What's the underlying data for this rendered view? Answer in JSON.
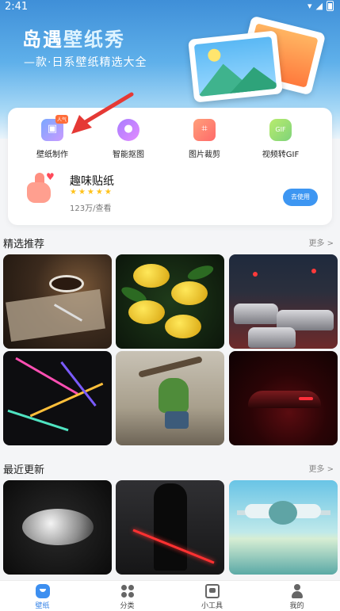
{
  "status_bar": {
    "time": "2:41"
  },
  "hero": {
    "title_part1": "岛遇",
    "title_part2": "壁纸秀",
    "subtitle": "—款·日系壁纸精选大全"
  },
  "tools": [
    {
      "label": "壁纸制作",
      "icon": "wallpaper-maker-icon",
      "badge": "人气"
    },
    {
      "label": "智能抠图",
      "icon": "cutout-icon"
    },
    {
      "label": "图片裁剪",
      "icon": "crop-icon"
    },
    {
      "label": "视频转GIF",
      "icon": "gif-icon",
      "icon_text": "GIF"
    }
  ],
  "sticker": {
    "title": "趣味贴纸",
    "stars": "★★★★★",
    "usage": "123万/查看",
    "button": "去使用"
  },
  "featured": {
    "title": "精选推荐",
    "more": "更多 >",
    "tiles": [
      {
        "subject": "coffee-and-pen"
      },
      {
        "subject": "lemons"
      },
      {
        "subject": "city-traffic"
      },
      {
        "subject": "neon-shards"
      },
      {
        "subject": "hulk"
      },
      {
        "subject": "red-car"
      }
    ]
  },
  "recent": {
    "title": "最近更新",
    "more": "更多 >",
    "tiles": [
      {
        "subject": "white-rose"
      },
      {
        "subject": "dark-warrior"
      },
      {
        "subject": "airplane"
      }
    ]
  },
  "tabbar": [
    {
      "label": "壁纸",
      "icon": "wallpaper-tab-icon",
      "active": true
    },
    {
      "label": "分类",
      "icon": "category-tab-icon",
      "active": false
    },
    {
      "label": "小工具",
      "icon": "tools-tab-icon",
      "active": false
    },
    {
      "label": "我的",
      "icon": "profile-tab-icon",
      "active": false
    }
  ],
  "colors": {
    "accent": "#3d96f2",
    "star": "#ffc21a",
    "arrow": "#e53935"
  }
}
